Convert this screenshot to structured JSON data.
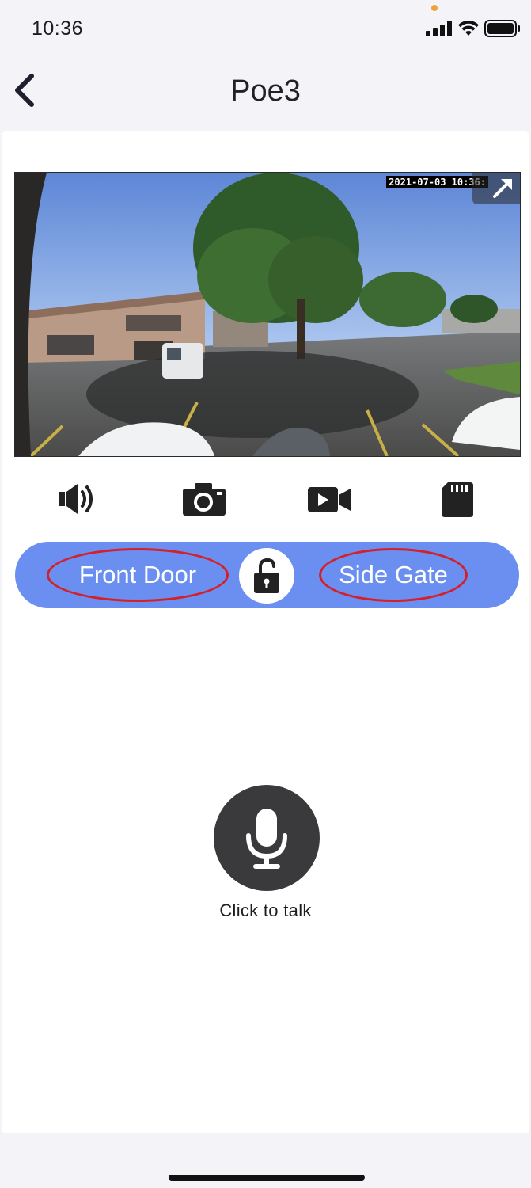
{
  "status_bar": {
    "time": "10:36"
  },
  "nav": {
    "title": "Poe3"
  },
  "video": {
    "timestamp": "2021-07-03 10:36:"
  },
  "lock_bar": {
    "front_label": "Front Door",
    "side_label": "Side Gate"
  },
  "talk": {
    "label": "Click to talk"
  },
  "colors": {
    "accent": "#6b8ff0",
    "highlight_ring": "#d3212b",
    "mic_bg": "#3a3a3c"
  },
  "icons": [
    "chevron-left-icon",
    "speaker-icon",
    "camera-icon",
    "video-record-icon",
    "sd-card-icon",
    "unlock-icon",
    "microphone-icon",
    "expand-icon"
  ]
}
